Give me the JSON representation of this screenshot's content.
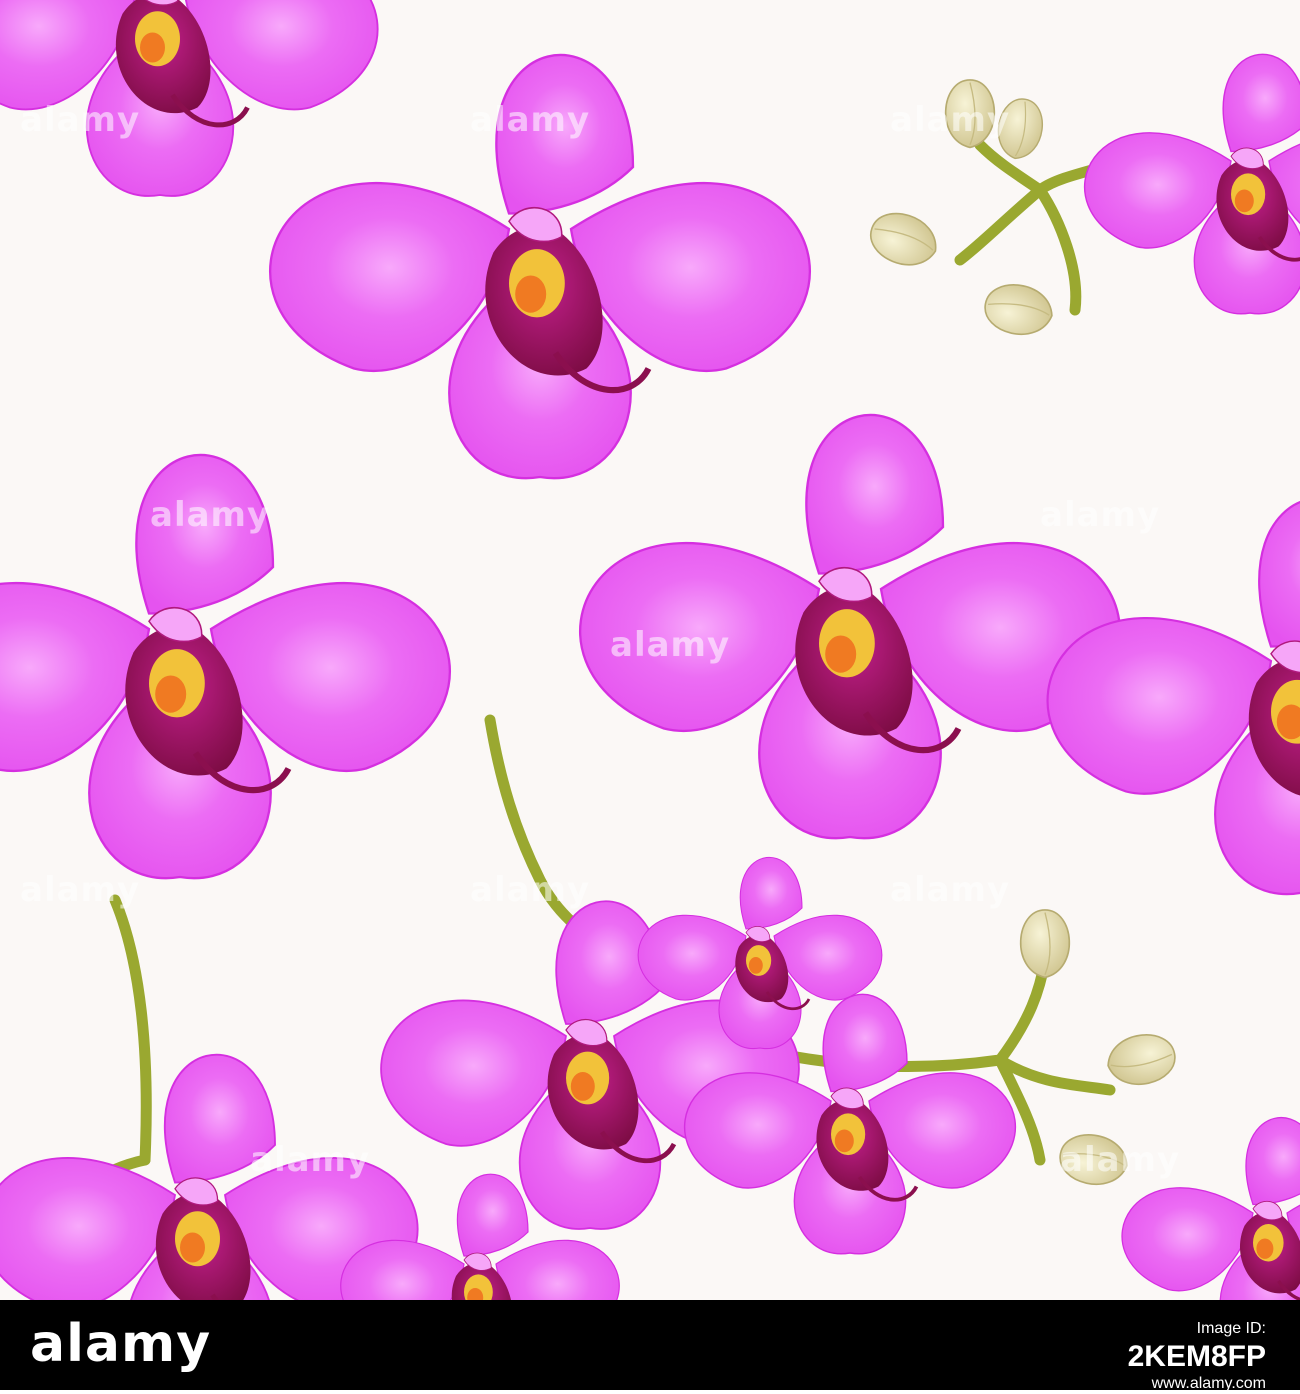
{
  "artwork": {
    "colors": {
      "background": "#fbf8f6",
      "petal": "#e95af2",
      "petal_glow": "#f9b8fb",
      "petal_edge": "#d52fe0",
      "lip_dark": "#8b0f4e",
      "lip_mid": "#b0197d",
      "column": "#f2c23a",
      "column_orange": "#f07a22",
      "stem": "#9aa830",
      "stem_dark": "#6f7a1c",
      "bud": "#e9e2b4",
      "bud_shadow": "#c6bb82"
    },
    "watermark_text": "alamy"
  },
  "footer": {
    "logo": "alamy",
    "image_id_label": "Image ID:",
    "image_id": "2KEM8FP",
    "site": "www.alamy.com"
  }
}
